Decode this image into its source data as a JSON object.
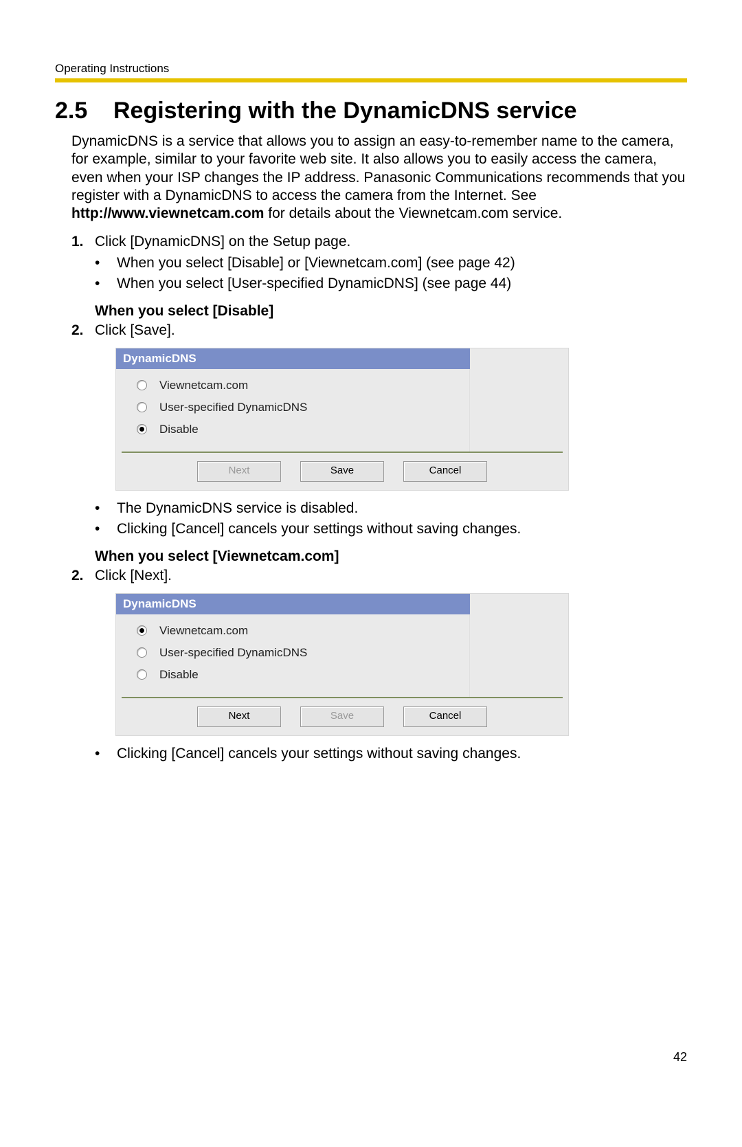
{
  "header": "Operating Instructions",
  "section_number": "2.5",
  "section_title": "Registering with the DynamicDNS service",
  "intro_parts": {
    "p1": "DynamicDNS is a service that allows you to assign an easy-to-remember name to the camera, for example, similar to your favorite web site. It also allows you to easily access the camera, even when your ISP changes the IP address. Panasonic Communications recommends that you register with a DynamicDNS to access the camera from the Internet. See ",
    "url": "http://www.viewnetcam.com",
    "p2": " for details about the Viewnetcam.com service."
  },
  "step1": {
    "num": "1.",
    "text": "Click [DynamicDNS] on the Setup page.",
    "bullets": [
      "When you select [Disable] or [Viewnetcam.com] (see page 42)",
      "When you select [User-specified DynamicDNS] (see page 44)"
    ]
  },
  "sectionA": {
    "heading": "When you select [Disable]",
    "step": {
      "num": "2.",
      "text": "Click [Save]."
    },
    "panel": {
      "title": "DynamicDNS",
      "options": [
        {
          "label": "Viewnetcam.com",
          "selected": false
        },
        {
          "label": "User-specified DynamicDNS",
          "selected": false
        },
        {
          "label": "Disable",
          "selected": true
        }
      ],
      "buttons": [
        {
          "label": "Next",
          "disabled": true
        },
        {
          "label": "Save",
          "disabled": false
        },
        {
          "label": "Cancel",
          "disabled": false
        }
      ]
    },
    "after_bullets": [
      "The DynamicDNS service is disabled.",
      "Clicking [Cancel] cancels your settings without saving changes."
    ]
  },
  "sectionB": {
    "heading": "When you select [Viewnetcam.com]",
    "step": {
      "num": "2.",
      "text": "Click [Next]."
    },
    "panel": {
      "title": "DynamicDNS",
      "options": [
        {
          "label": "Viewnetcam.com",
          "selected": true
        },
        {
          "label": "User-specified DynamicDNS",
          "selected": false
        },
        {
          "label": "Disable",
          "selected": false
        }
      ],
      "buttons": [
        {
          "label": "Next",
          "disabled": false
        },
        {
          "label": "Save",
          "disabled": true
        },
        {
          "label": "Cancel",
          "disabled": false
        }
      ]
    },
    "after_bullets": [
      "Clicking [Cancel] cancels your settings without saving changes."
    ]
  },
  "page_number": "42"
}
